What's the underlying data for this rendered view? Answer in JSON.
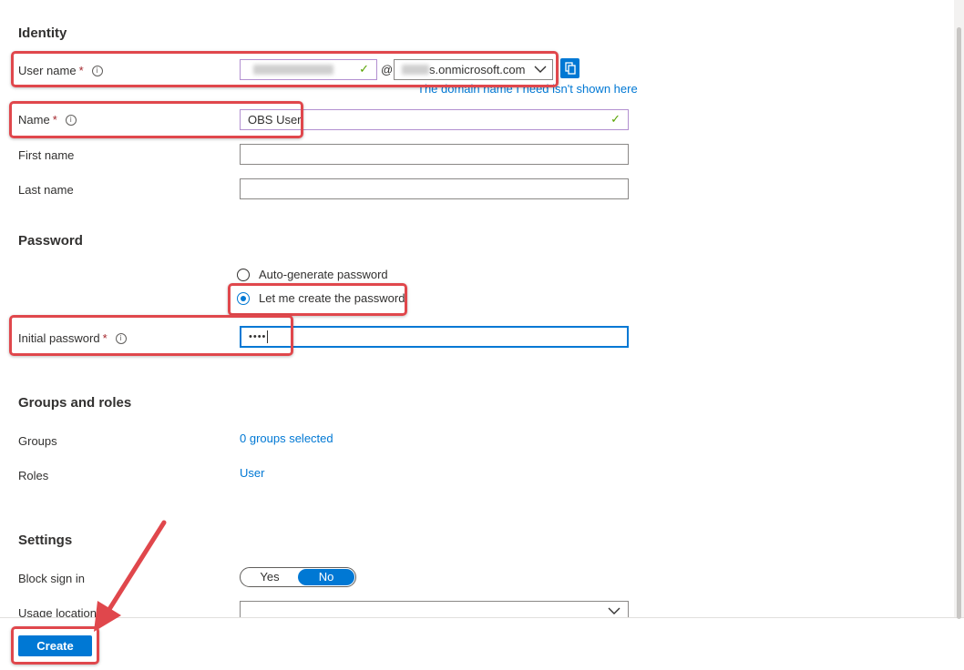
{
  "identity": {
    "title": "Identity",
    "username_label": "User name",
    "required_mark": "*",
    "info_glyph": "i",
    "at_sign": "@",
    "domain_value": "s.onmicrosoft.com",
    "domain_link": "The domain name I need isn't shown here",
    "name_label": "Name",
    "name_value": "OBS User",
    "first_name_label": "First name",
    "last_name_label": "Last name"
  },
  "password": {
    "title": "Password",
    "option_auto": "Auto-generate password",
    "option_manual": "Let me create the password",
    "initial_label": "Initial password",
    "initial_value": "••••"
  },
  "groups_roles": {
    "title": "Groups and roles",
    "groups_label": "Groups",
    "groups_value": "0 groups selected",
    "roles_label": "Roles",
    "roles_value": "User"
  },
  "settings": {
    "title": "Settings",
    "block_label": "Block sign in",
    "toggle_yes": "Yes",
    "toggle_no": "No",
    "usage_label": "Usage location"
  },
  "footer": {
    "create_label": "Create"
  },
  "icons": {
    "check": "✓",
    "chevron": "chevron-down-icon",
    "copy": "copy-icon"
  },
  "colors": {
    "accent": "#0078d4",
    "highlight": "#e0474c",
    "required": "#a4262c",
    "valid": "#57a300"
  }
}
